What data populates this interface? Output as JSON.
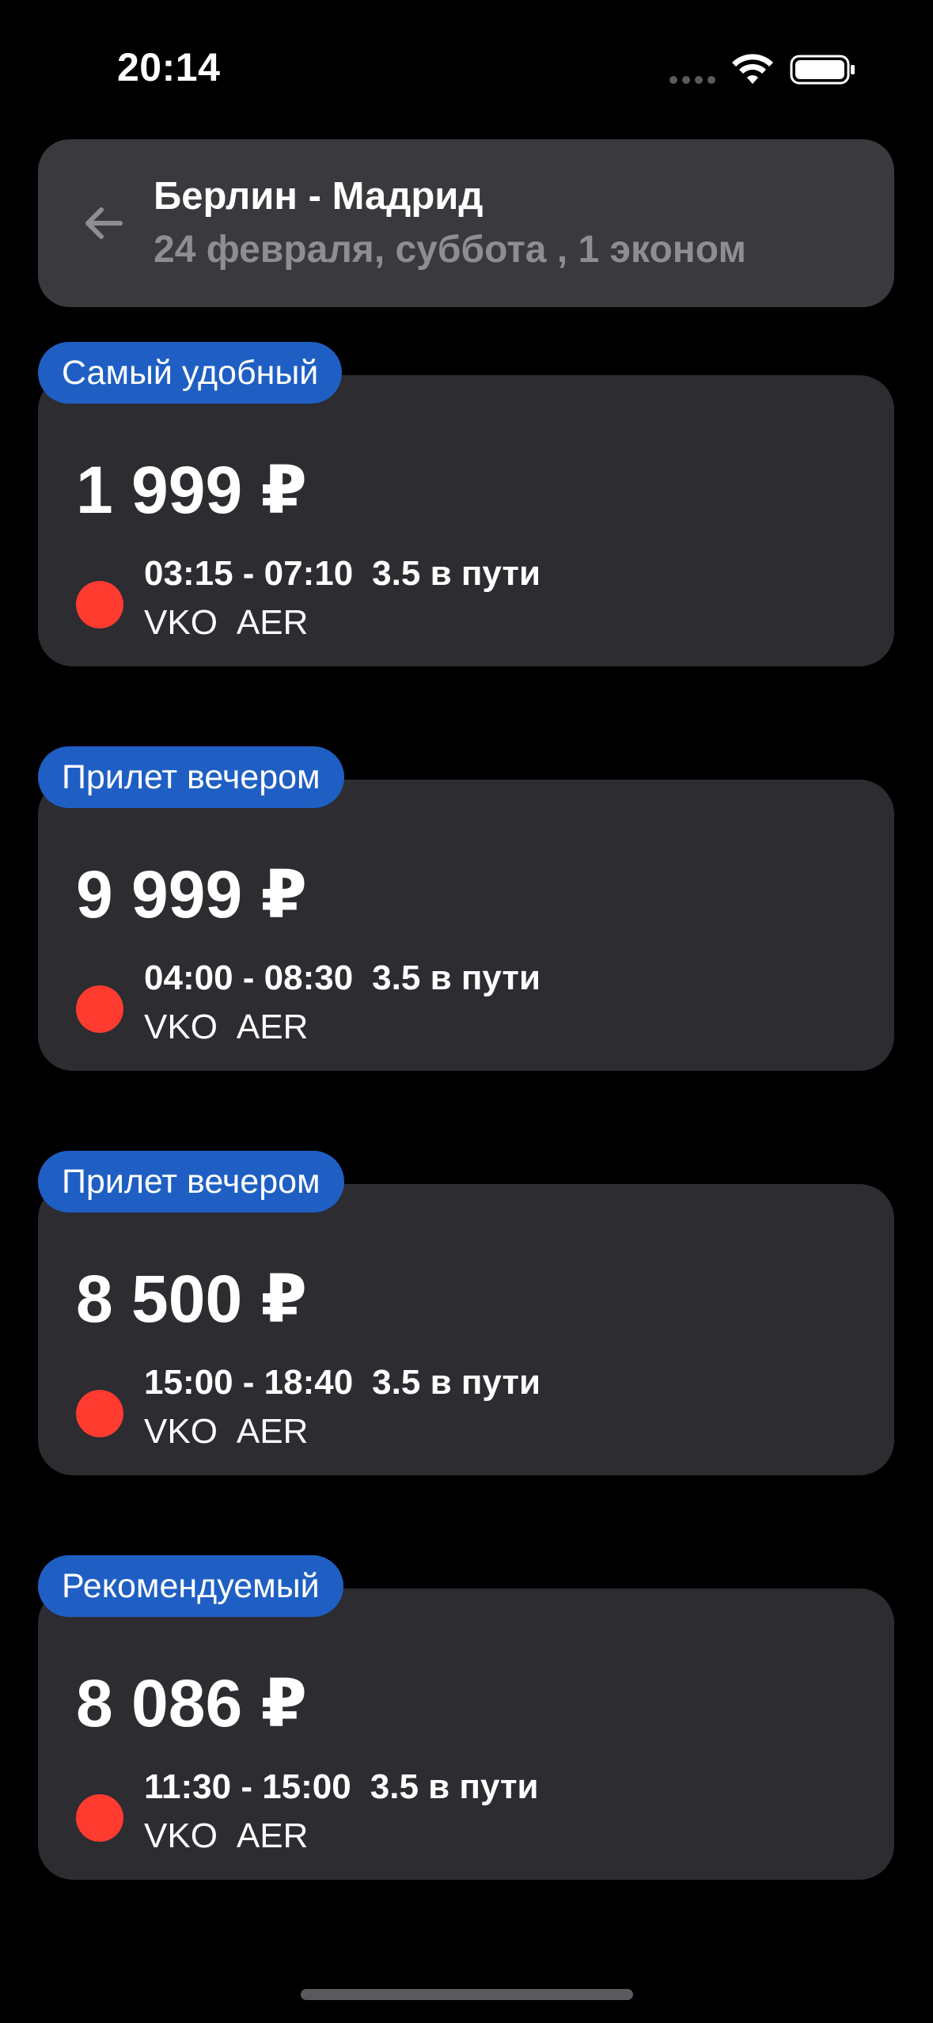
{
  "status_bar": {
    "time": "20:14"
  },
  "header": {
    "title": "Берлин - Мадрид",
    "subtitle": "24 февраля, суббота , 1 эконом",
    "back_icon": "arrow-left-icon"
  },
  "colors": {
    "background": "#000000",
    "card": "#2c2c31",
    "header_card": "#3a3a3e",
    "badge": "#1f5fc4",
    "airline_dot": "#ff3b30",
    "subtitle": "#8d8d92"
  },
  "offers": [
    {
      "badge": "Самый удобный",
      "price": "1 999 ₽",
      "times": "03:15 - 07:10",
      "duration": "3.5 в пути",
      "from": "VKO",
      "to": "AER"
    },
    {
      "badge": "Прилет вечером",
      "price": "9 999 ₽",
      "times": "04:00 - 08:30",
      "duration": "3.5 в пути",
      "from": "VKO",
      "to": "AER"
    },
    {
      "badge": "Прилет вечером",
      "price": "8 500 ₽",
      "times": "15:00 - 18:40",
      "duration": "3.5 в пути",
      "from": "VKO",
      "to": "AER"
    },
    {
      "badge": "Рекомендуемый",
      "price": "8 086 ₽",
      "times": "11:30 - 15:00",
      "duration": "3.5 в пути",
      "from": "VKO",
      "to": "AER"
    }
  ]
}
